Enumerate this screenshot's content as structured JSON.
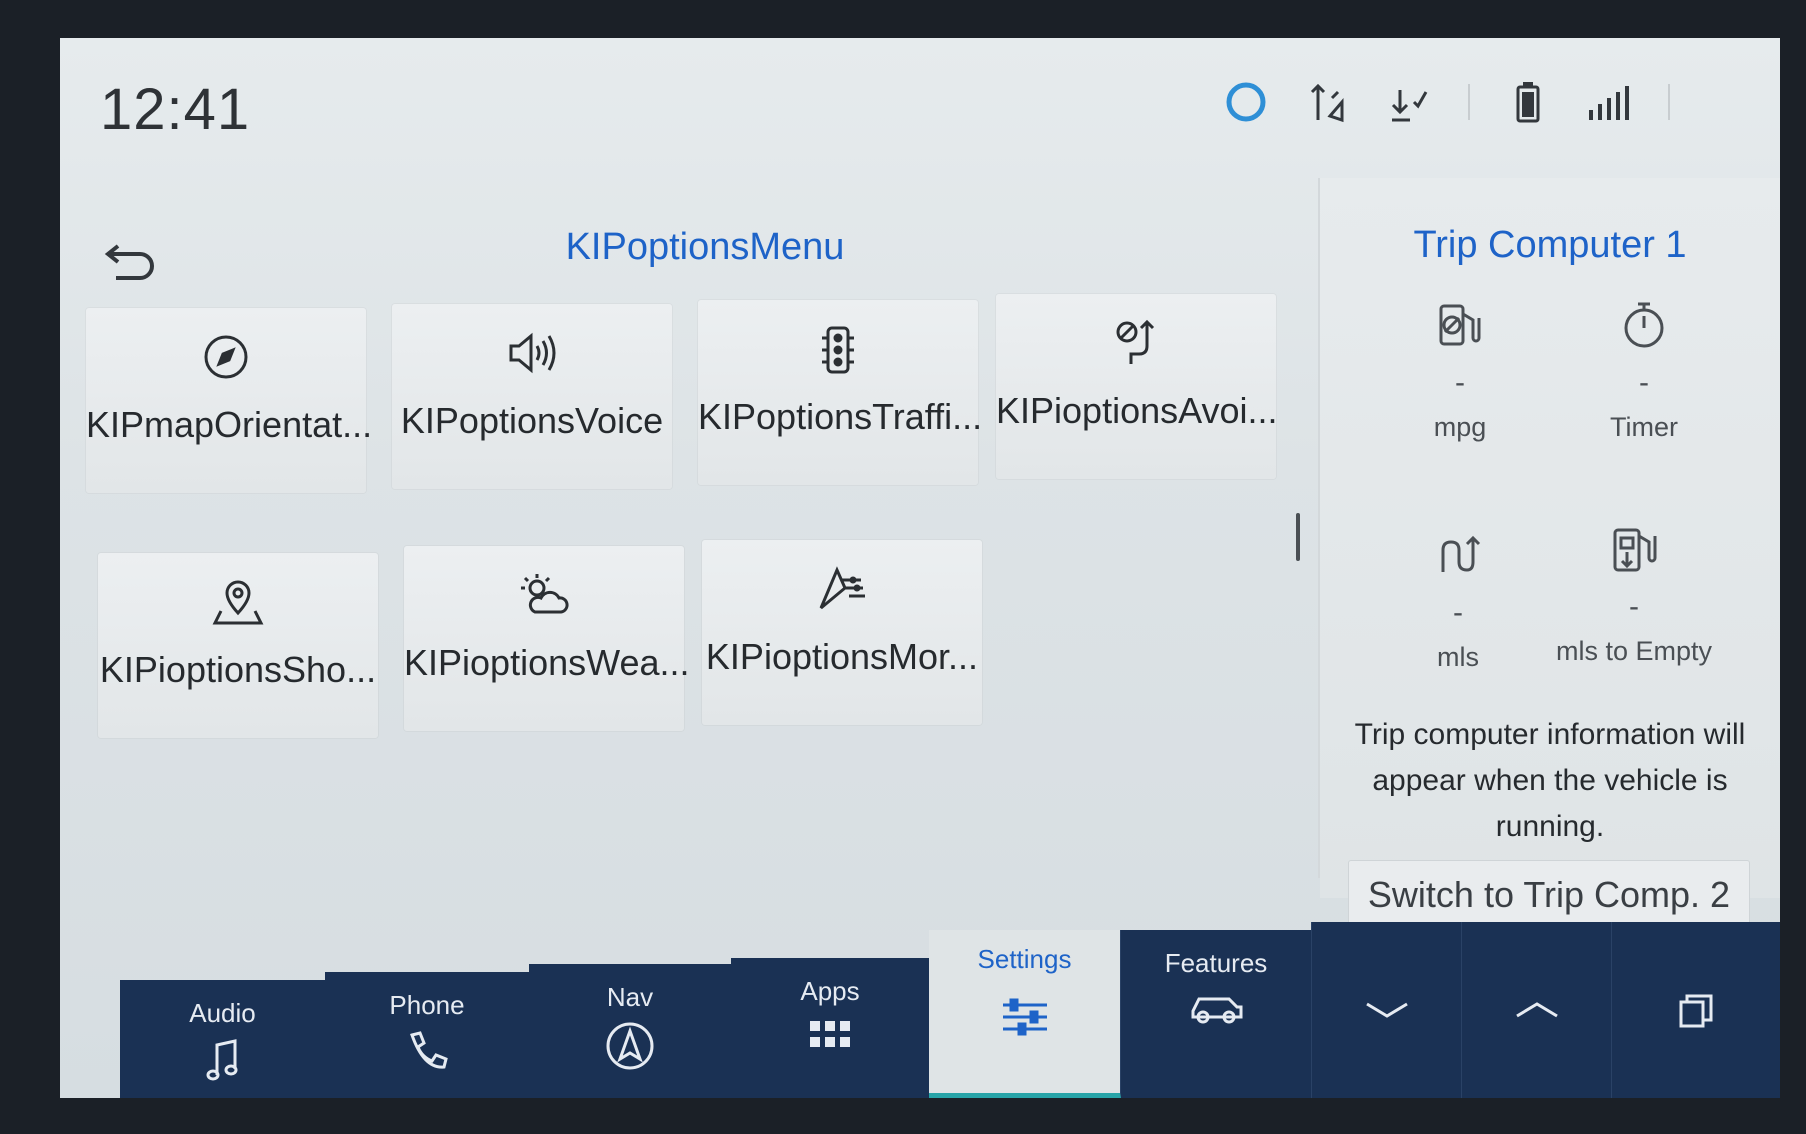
{
  "status": {
    "time": "12:41",
    "icons": [
      "voice-assistant-ring-icon",
      "sync-arrows-icon",
      "download-check-icon",
      "battery-icon",
      "signal-icon"
    ]
  },
  "menu": {
    "title": "KIPoptionsMenu",
    "tiles": [
      {
        "label": "KIPmapOrientat...",
        "icon": "compass-icon"
      },
      {
        "label": "KIPoptionsVoice",
        "icon": "speaker-icon"
      },
      {
        "label": "KIPoptionsTraffi...",
        "icon": "traffic-light-icon"
      },
      {
        "label": "KIPioptionsAvoi...",
        "icon": "avoid-route-icon"
      },
      {
        "label": "KIPioptionsSho...",
        "icon": "map-pin-icon"
      },
      {
        "label": "KIPioptionsWea...",
        "icon": "weather-icon"
      },
      {
        "label": "KIPioptionsMor...",
        "icon": "more-options-icon"
      }
    ]
  },
  "trip": {
    "title": "Trip Computer 1",
    "metrics": [
      {
        "value": "-",
        "unit": "mpg",
        "icon": "fuel-economy-icon"
      },
      {
        "value": "-",
        "unit": "Timer",
        "icon": "stopwatch-icon"
      },
      {
        "value": "-",
        "unit": "mls",
        "icon": "distance-icon"
      },
      {
        "value": "-",
        "unit": "mls to Empty",
        "icon": "fuel-range-icon"
      }
    ],
    "info": "Trip computer information will appear when the vehicle is running.",
    "switch_label": "Switch to Trip Comp. 2"
  },
  "nav": {
    "items": [
      {
        "label": "Audio",
        "icon": "music-note-icon"
      },
      {
        "label": "Phone",
        "icon": "phone-icon"
      },
      {
        "label": "Nav",
        "icon": "navigation-icon"
      },
      {
        "label": "Apps",
        "icon": "apps-grid-icon"
      },
      {
        "label": "Settings",
        "icon": "sliders-icon",
        "active": true
      },
      {
        "label": "Features",
        "icon": "car-icon"
      }
    ],
    "controls": [
      "chevron-down-icon",
      "chevron-up-icon",
      "windows-icon"
    ]
  },
  "colors": {
    "accent": "#1e63c8",
    "nav_bg": "#1a3154",
    "active_underline": "#27a4a8"
  }
}
